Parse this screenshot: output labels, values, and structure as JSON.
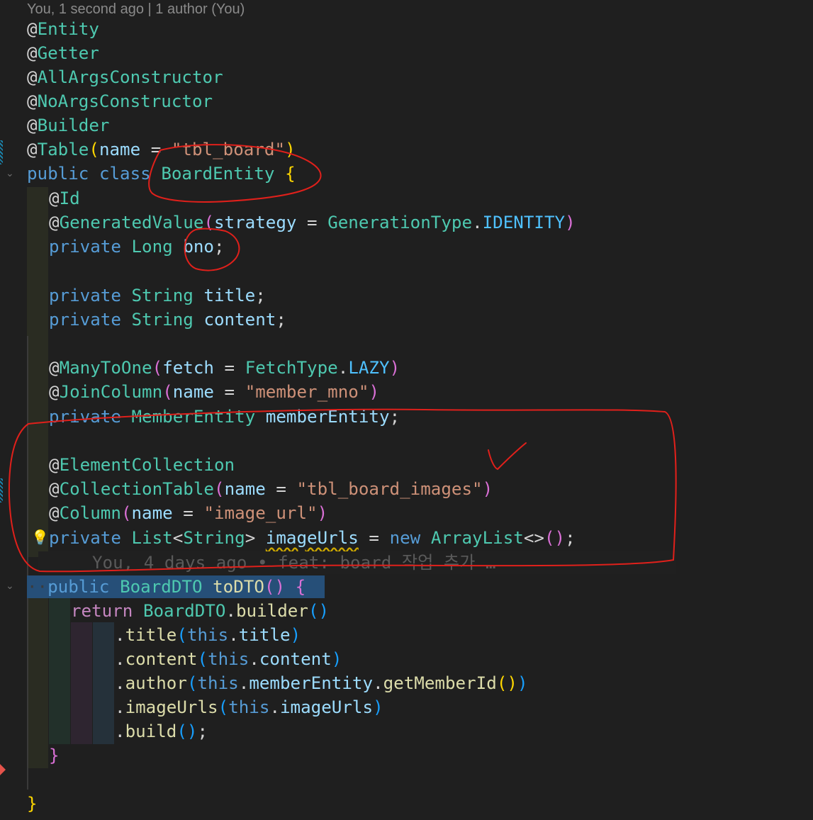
{
  "codelens": "You, 1 second ago | 1 author (You)",
  "blame_hint": "You, 4 days ago • feat: board 작업 추가 …",
  "code": {
    "l1_at": "@",
    "l1_ann": "Entity",
    "l2_at": "@",
    "l2_ann": "Getter",
    "l3_at": "@",
    "l3_ann": "AllArgsConstructor",
    "l4_at": "@",
    "l4_ann": "NoArgsConstructor",
    "l5_at": "@",
    "l5_ann": "Builder",
    "l6_at": "@",
    "l6_ann": "Table",
    "l6_p1": "(",
    "l6_name": "name",
    "l6_eq": " = ",
    "l6_str": "\"tbl_board\"",
    "l6_p2": ")",
    "l7_public": "public",
    "l7_class": "class",
    "l7_name": "BoardEntity",
    "l7_brace": "{",
    "l8_at": "@",
    "l8_ann": "Id",
    "l9_at": "@",
    "l9_ann": "GeneratedValue",
    "l9_p1": "(",
    "l9_key": "strategy",
    "l9_eq": " = ",
    "l9_type": "GenerationType",
    "l9_dot": ".",
    "l9_val": "IDENTITY",
    "l9_p2": ")",
    "l10_private": "private",
    "l10_type": "Long",
    "l10_name": "bno",
    "l10_semi": ";",
    "l11_private": "private",
    "l11_type": "String",
    "l11_name": "title",
    "l11_semi": ";",
    "l12_private": "private",
    "l12_type": "String",
    "l12_name": "content",
    "l12_semi": ";",
    "l13_at": "@",
    "l13_ann": "ManyToOne",
    "l13_p1": "(",
    "l13_key": "fetch",
    "l13_eq": " = ",
    "l13_type": "FetchType",
    "l13_dot": ".",
    "l13_val": "LAZY",
    "l13_p2": ")",
    "l14_at": "@",
    "l14_ann": "JoinColumn",
    "l14_p1": "(",
    "l14_key": "name",
    "l14_eq": " = ",
    "l14_str": "\"member_mno\"",
    "l14_p2": ")",
    "l15_private": "private",
    "l15_type": "MemberEntity",
    "l15_name": "memberEntity",
    "l15_semi": ";",
    "l16_at": "@",
    "l16_ann": "ElementCollection",
    "l17_at": "@",
    "l17_ann": "CollectionTable",
    "l17_p1": "(",
    "l17_key": "name",
    "l17_eq": " = ",
    "l17_str": "\"tbl_board_images\"",
    "l17_p2": ")",
    "l18_at": "@",
    "l18_ann": "Column",
    "l18_p1": "(",
    "l18_key": "name",
    "l18_eq": " = ",
    "l18_str": "\"image_url\"",
    "l18_p2": ")",
    "l19_private": "private",
    "l19_type": "List",
    "l19_lt": "<",
    "l19_gen": "String",
    "l19_gt": ">",
    "l19_name": "imageUrls",
    "l19_eq": " = ",
    "l19_new": "new",
    "l19_ctor": "ArrayList",
    "l19_dia": "<>",
    "l19_p": "()",
    "l19_semi": ";",
    "l20_ws": "··",
    "l20_public": "public",
    "l20_type": "BoardDTO",
    "l20_fn": "toDTO",
    "l20_p": "()",
    "l20_brace": "{",
    "l21_return": "return",
    "l21_type": "BoardDTO",
    "l21_dot": ".",
    "l21_fn": "builder",
    "l21_p": "()",
    "l22_dot": ".",
    "l22_fn": "title",
    "l22_p1": "(",
    "l22_this": "this",
    "l22_dot2": ".",
    "l22_field": "title",
    "l22_p2": ")",
    "l23_dot": ".",
    "l23_fn": "content",
    "l23_p1": "(",
    "l23_this": "this",
    "l23_dot2": ".",
    "l23_field": "content",
    "l23_p2": ")",
    "l24_dot": ".",
    "l24_fn": "author",
    "l24_p1": "(",
    "l24_this": "this",
    "l24_dot2": ".",
    "l24_field": "memberEntity",
    "l24_dot3": ".",
    "l24_fn2": "getMemberId",
    "l24_p3": "()",
    "l24_p2": ")",
    "l25_dot": ".",
    "l25_fn": "imageUrls",
    "l25_p1": "(",
    "l25_this": "this",
    "l25_dot2": ".",
    "l25_field": "imageUrls",
    "l25_p2": ")",
    "l26_dot": ".",
    "l26_fn": "build",
    "l26_p": "()",
    "l26_semi": ";",
    "l27_brace": "}",
    "l28_brace": "}"
  },
  "icons": {
    "fold_open": "⌄",
    "lightbulb": "💡"
  },
  "colors": {
    "background": "#1f1f1f",
    "keyword": "#569cd6",
    "type": "#4ec9b0",
    "string": "#ce9178",
    "annotation_pen": "#e0201b",
    "selection": "#264f78"
  }
}
